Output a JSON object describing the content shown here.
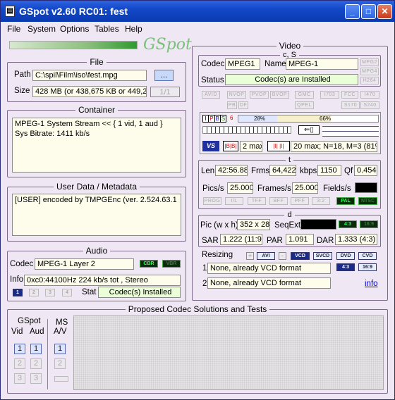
{
  "window": {
    "title": "GSpot v2.60 RC01: fest",
    "app_icon": "film-icon"
  },
  "menu": [
    "File",
    "System",
    "Options",
    "Tables",
    "Help"
  ],
  "logo": "GSpot",
  "file": {
    "legend": "File",
    "path_label": "Path",
    "path": "C:\\spil\\Film\\iso\\fest.mpg",
    "browse_label": "...",
    "size_label": "Size",
    "size": "428 MB (or 438,675 KB or 449,20",
    "page": "1/1"
  },
  "container": {
    "legend": "Container",
    "lines": [
      "MPEG-1 System Stream << { 1 vid, 1 aud }",
      "Sys Bitrate: 1411 kb/s"
    ]
  },
  "metadata": {
    "legend": "User Data / Metadata",
    "text": "[USER]    encoded by TMPGEnc (ver. 2.524.63.1"
  },
  "audio": {
    "legend": "Audio",
    "codec_label": "Codec",
    "codec": "MPEG-1 Layer 2",
    "cbr": "CBR",
    "vbr": "VBR",
    "info_label": "Info",
    "info": "0xc0:44100Hz  224 kb/s tot , Stereo",
    "streams": [
      "1",
      "2",
      "3",
      "4"
    ],
    "stat_label": "Stat",
    "stat": "Codec(s) Installed"
  },
  "video": {
    "legend": "Video",
    "cs_legend": "c, S",
    "codec_label": "Codec",
    "codec": "MPEG1",
    "name_label": "Name",
    "name": "MPEG-1",
    "status_label": "Status",
    "status": "Codec(s) are Installed",
    "badges": [
      "MPG2",
      "MPG4",
      "H264"
    ],
    "flags1": [
      "AVID",
      "NVOP",
      "PVOP",
      "BVOP",
      "GMC",
      "I703",
      "FCC",
      "I470"
    ],
    "flags2": [
      "PB",
      "DF",
      "QPEL",
      "S170",
      "S240"
    ],
    "gop": {
      "frame_types": [
        "I",
        "P",
        "B",
        "S"
      ],
      "six": "6",
      "pct1": "28%",
      "pct2": "66%",
      "b_pct": 28,
      "p_pct": 66
    },
    "gop_row": {
      "max": "2 max",
      "info": "20 max; N=18, M=3 (81%"
    },
    "t_legend": "t",
    "len_label": "Len",
    "len": "42:56.88(",
    "frms_label": "Frms",
    "frms": "64,422",
    "kbps_label": "kbps",
    "kbps": "1150",
    "qf_label": "Qf",
    "qf": "0.454",
    "pics_label": "Pics/s",
    "pics": "25.000",
    "frames_label": "Frames/s",
    "frames": "25.000",
    "fields_label": "Fields/s",
    "tflags": [
      "PROG",
      "I/L",
      "TFF",
      "BFF",
      "PFF",
      "3:2"
    ],
    "pal": "PAL",
    "ntsc": "NTSC",
    "d_legend": "d",
    "pic_label": "Pic (w x h)",
    "pic": "352 x 288",
    "seqext_label": "SeqExt",
    "ar43": "4:3",
    "ar169": "16:9",
    "sar_label": "SAR",
    "sar": "1.222 (11:9)",
    "par_label": "PAR",
    "par": "1.091",
    "dar_label": "DAR",
    "dar": "1.333 (4:3)",
    "resizing_label": "Resizing",
    "resize_btns": [
      "AVI",
      "VCD",
      "SVCD",
      "DVD",
      "CVD"
    ],
    "r1_num": "1",
    "r1": "None, already VCD format",
    "r2_num": "2",
    "r2": "None, already VCD format",
    "info_link": "info"
  },
  "proposed": {
    "legend": "Proposed Codec Solutions and Tests",
    "gspot_label": "GSpot",
    "vid_label": "Vid",
    "aud_label": "Aud",
    "ms_label": "MS",
    "av_label": "A/V",
    "nums": [
      "1",
      "2",
      "3"
    ]
  },
  "colors": {
    "title": "#1248c8",
    "panel": "#efe8f4",
    "field": "#fefcea",
    "status": "#eaffd8"
  }
}
